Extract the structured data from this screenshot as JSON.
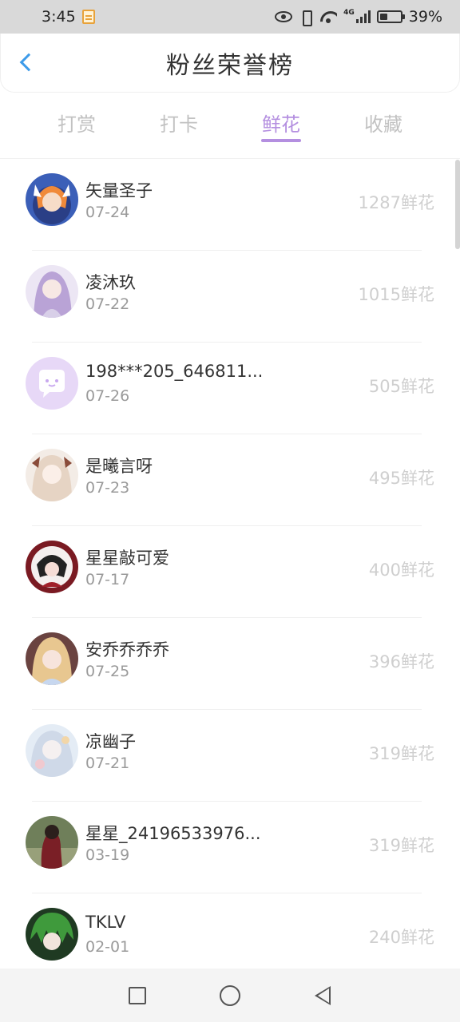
{
  "status_bar": {
    "time": "3:45",
    "network": "4G",
    "battery_text": "39%",
    "battery_level": 0.39
  },
  "header": {
    "title": "粉丝荣誉榜"
  },
  "tabs": [
    {
      "label": "打赏"
    },
    {
      "label": "打卡"
    },
    {
      "label": "鲜花",
      "active": true
    },
    {
      "label": "收藏"
    }
  ],
  "active_tab_color": "#b48fe0",
  "fans": [
    {
      "name": "矢量圣子",
      "date": "07-24",
      "score": "1287鲜花"
    },
    {
      "name": "凌沐玖",
      "date": "07-22",
      "score": "1015鲜花"
    },
    {
      "name": "198***205_646811...",
      "date": "07-26",
      "score": "505鲜花"
    },
    {
      "name": "是曦言呀",
      "date": "07-23",
      "score": "495鲜花"
    },
    {
      "name": "星星敲可爱",
      "date": "07-17",
      "score": "400鲜花"
    },
    {
      "name": "安乔乔乔乔",
      "date": "07-25",
      "score": "396鲜花"
    },
    {
      "name": "凉幽子",
      "date": "07-21",
      "score": "319鲜花"
    },
    {
      "name": "星星_24196533976...",
      "date": "03-19",
      "score": "319鲜花"
    },
    {
      "name": "TKLV",
      "date": "02-01",
      "score": "240鲜花"
    }
  ]
}
